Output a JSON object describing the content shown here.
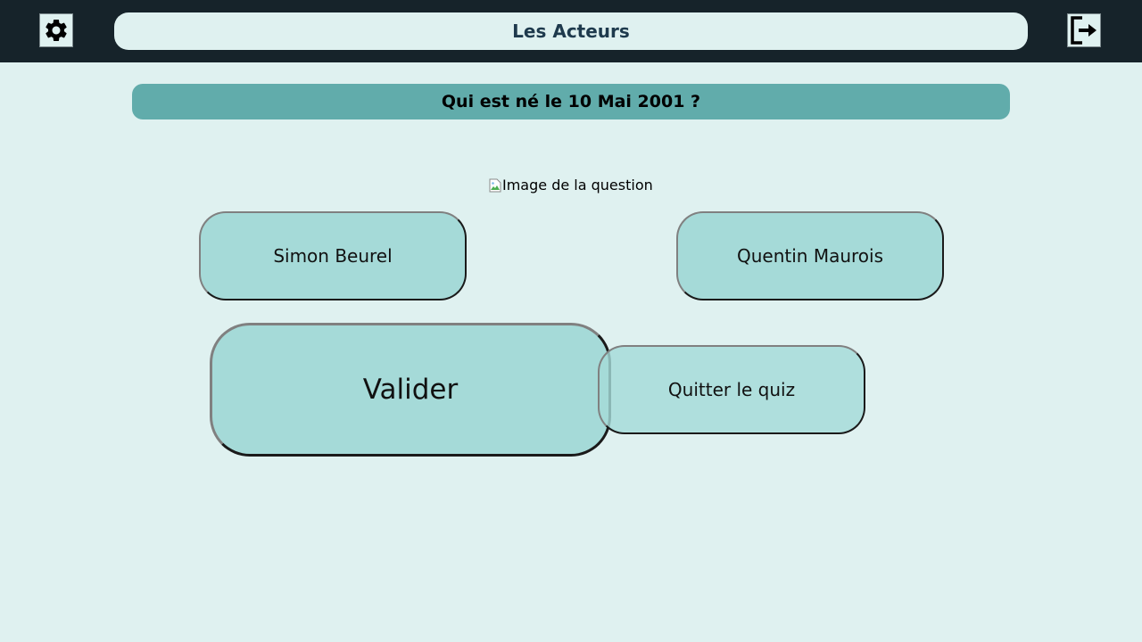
{
  "header": {
    "title": "Les Acteurs",
    "settings_icon": "gear-icon",
    "logout_icon": "logout-icon"
  },
  "question": {
    "text": "Qui est né le 10 Mai 2001 ?",
    "image_alt": "Image de la question"
  },
  "answers": [
    {
      "label": "Simon Beurel"
    },
    {
      "label": "Quentin Maurois"
    }
  ],
  "actions": {
    "validate_label": "Valider",
    "quit_label": "Quitter le quiz"
  },
  "colors": {
    "topbar": "#16232a",
    "background": "#dff1f0",
    "question_bar": "#61acab",
    "button": "#a5dad8",
    "title_text": "#1e3a4d"
  }
}
